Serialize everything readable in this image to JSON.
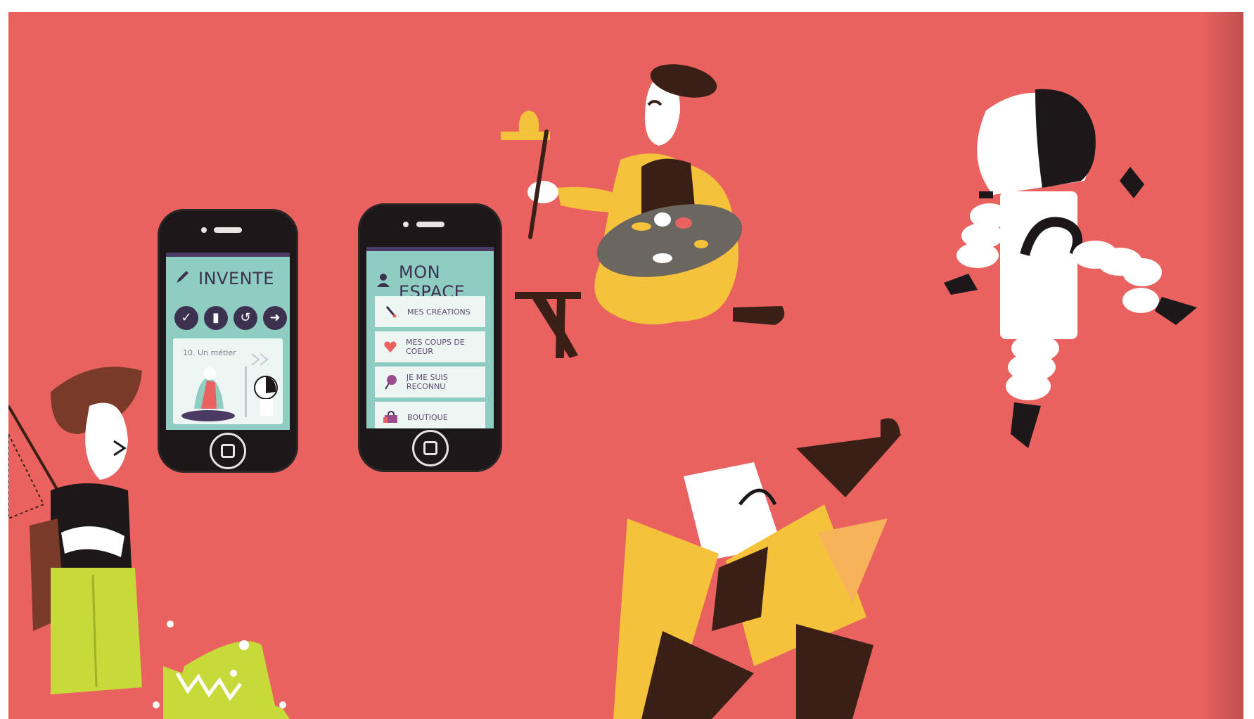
{
  "phones": [
    {
      "header_icon": "pencil-icon",
      "title": "INVENTE",
      "buttons": [
        {
          "icon": "check-icon",
          "glyph": "✓"
        },
        {
          "icon": "shirt-icon",
          "glyph": "▮"
        },
        {
          "icon": "undo-icon",
          "glyph": "↺"
        },
        {
          "icon": "forward-icon",
          "glyph": "➜"
        }
      ],
      "card_title": "10. Un métier"
    },
    {
      "header_icon": "user-icon",
      "title": "MON ESPACE",
      "menu": [
        {
          "icon": "brush-icon",
          "label": "MES CRÉATIONS"
        },
        {
          "icon": "heart-icon",
          "label": "MES COUPS DE COEUR"
        },
        {
          "icon": "lollipop-icon",
          "label": "JE ME SUIS RECONNU"
        },
        {
          "icon": "shop-icon",
          "label": "BOUTIQUE"
        }
      ]
    }
  ],
  "colors": {
    "background": "#E9625F",
    "phone_body": "#1c1718",
    "screen": "#8FCDC2",
    "accent_purple": "#3d3150",
    "yellow": "#F5C33B",
    "dark_brown": "#3a1f16",
    "lime": "#C8DA3A"
  }
}
